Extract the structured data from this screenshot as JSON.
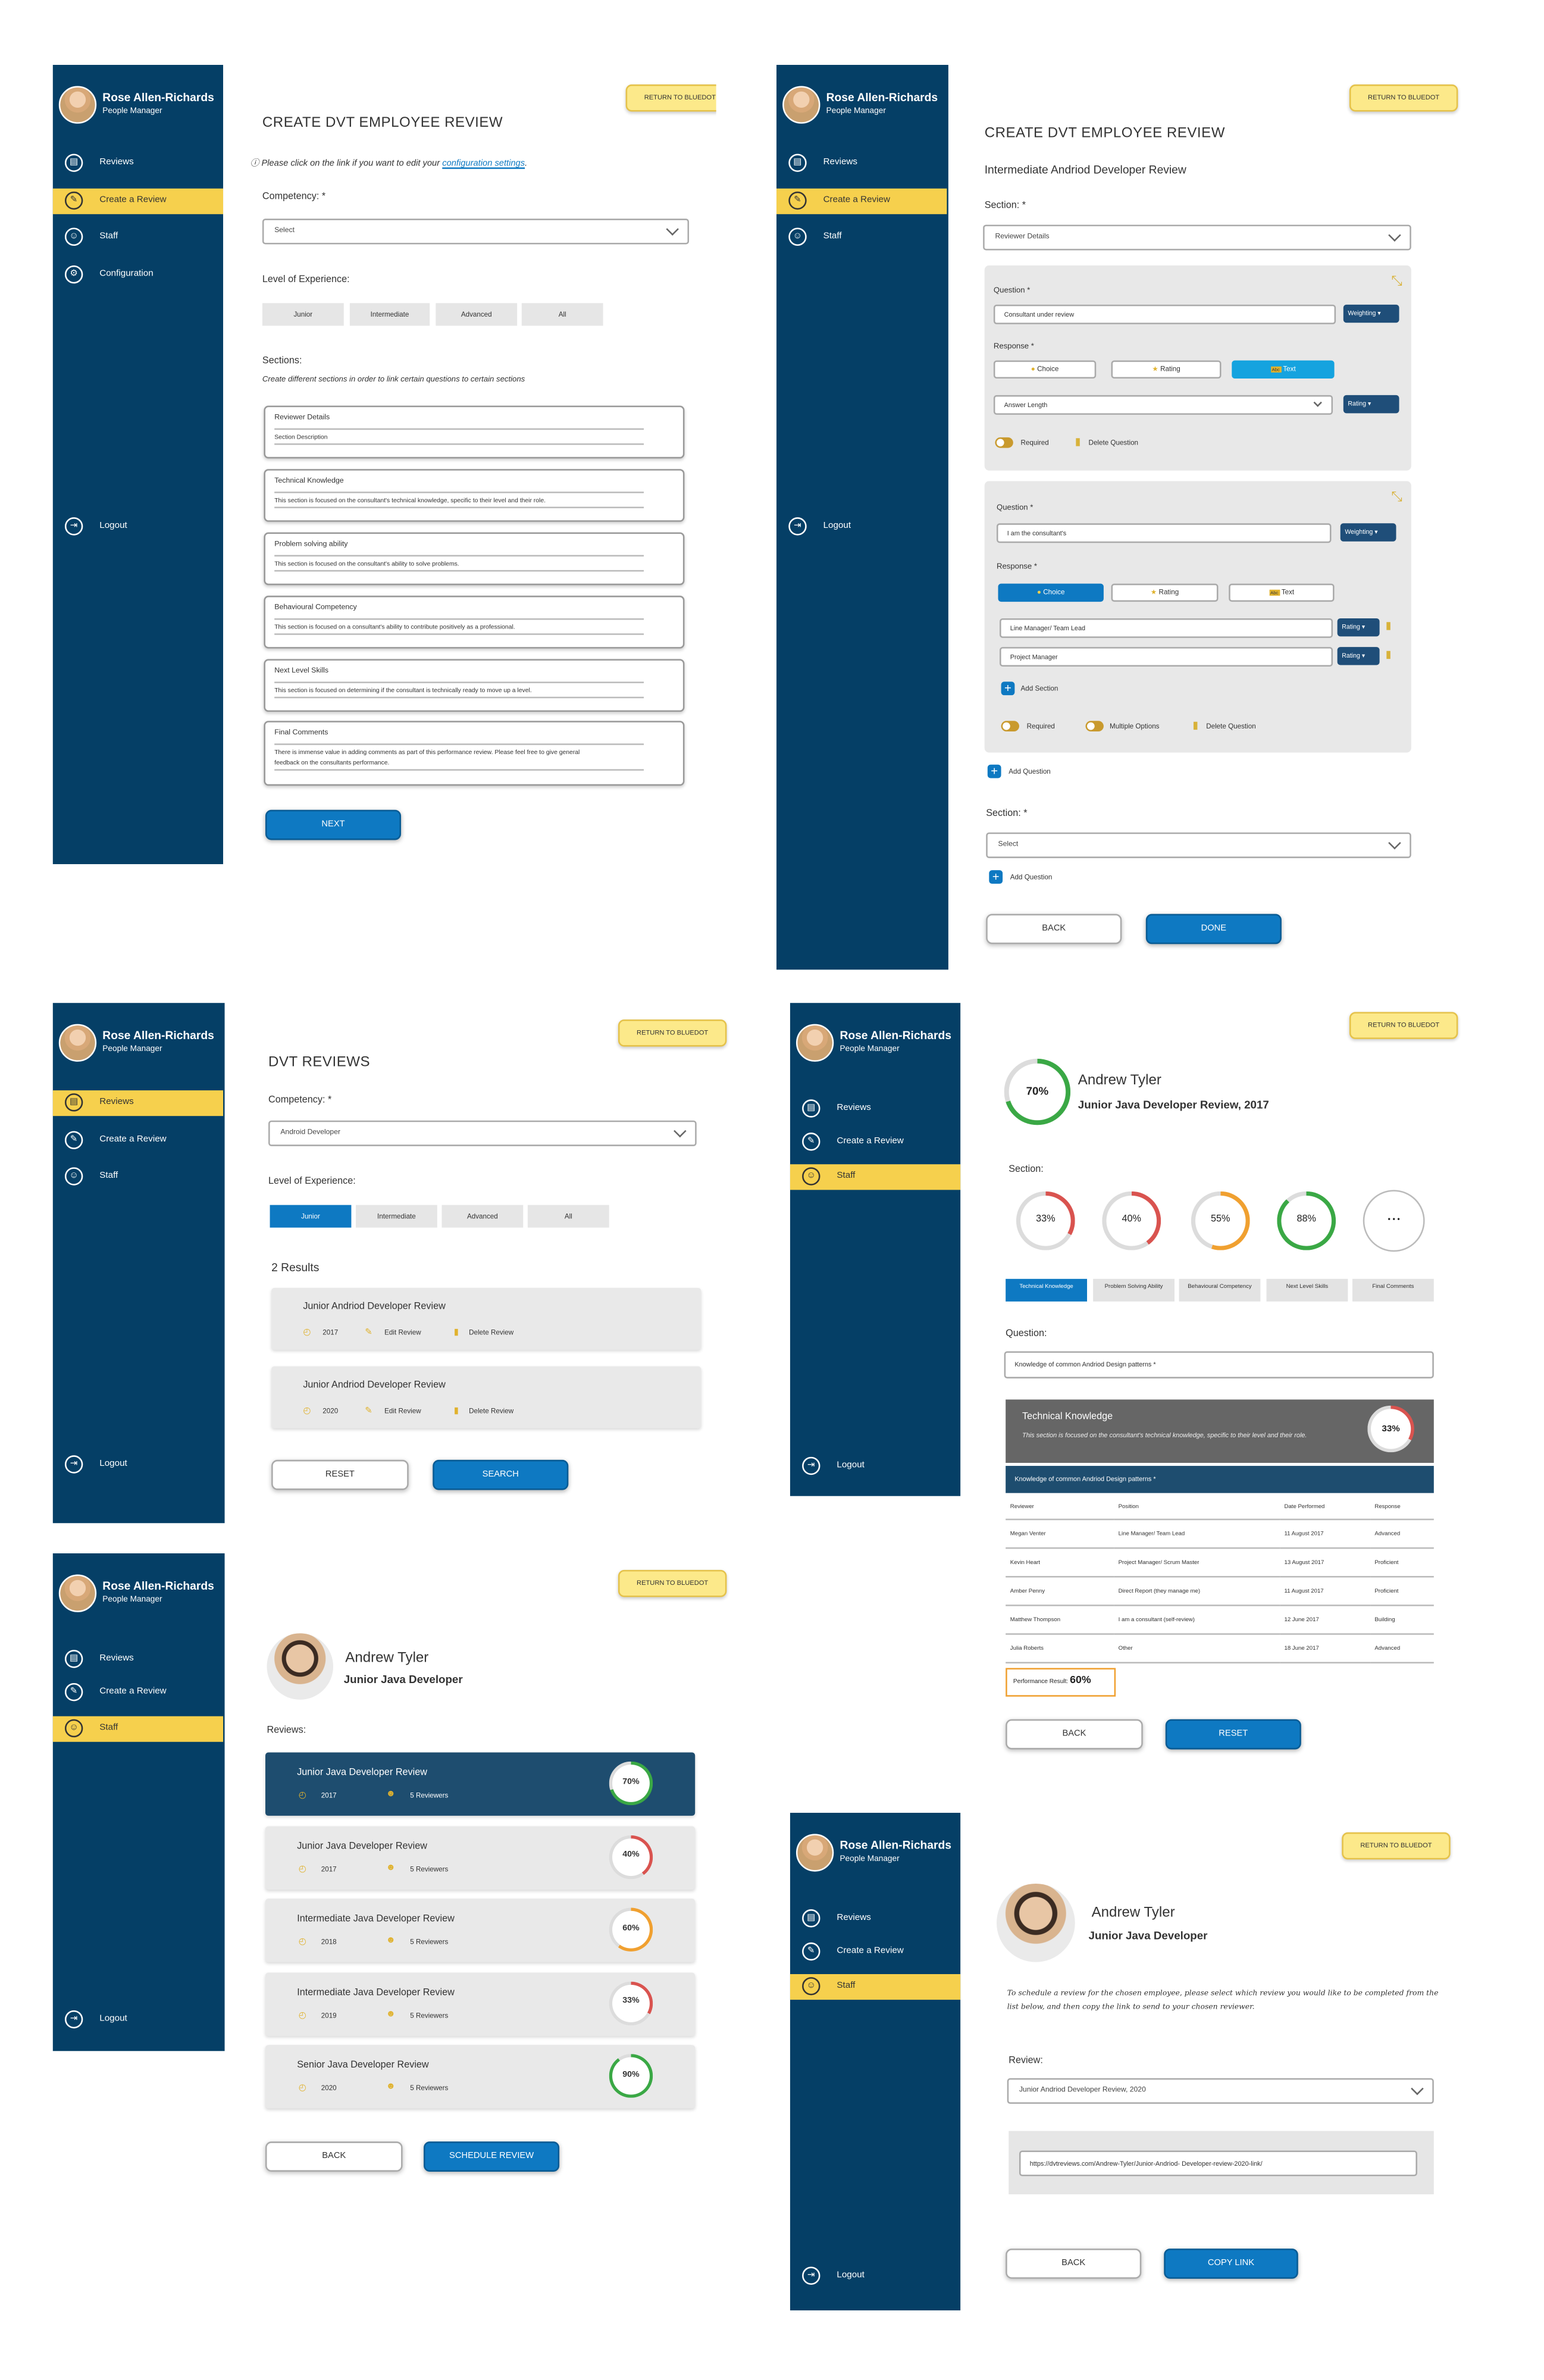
{
  "user": {
    "name": "Rose Allen-Richards",
    "role": "People Manager"
  },
  "return_label": "RETURN TO BLUEDOT",
  "logout": "Logout",
  "nav": {
    "reviews": "Reviews",
    "create": "Create a Review",
    "staff": "Staff",
    "config": "Configuration"
  },
  "p1": {
    "title": "CREATE DVT EMPLOYEE REVIEW",
    "note_pre": "Please click on the link if you want to edit your",
    "note_link": "configuration settings",
    "competency_label": "Competency: *",
    "competency_value": "Select",
    "level_label": "Level of Experience:",
    "levels": [
      "Junior",
      "Intermediate",
      "Advanced",
      "All"
    ],
    "sections_label": "Sections:",
    "sections_hint": "Create different sections in order to link certain questions to certain sections",
    "sections": [
      {
        "title": "Reviewer Details",
        "desc": "Section Description",
        "desc2": ""
      },
      {
        "title": "Technical Knowledge",
        "desc": "This section is focused on the consultant's technical knowledge, specific to their level and their role.",
        "desc2": ""
      },
      {
        "title": "Problem solving ability",
        "desc": "This section is focused on the consultant's ability to solve problems.",
        "desc2": ""
      },
      {
        "title": "Behavioural Competency",
        "desc": "This section is focused on a consultant's ability to contribute positively as a professional.",
        "desc2": ""
      },
      {
        "title": "Next Level Skills",
        "desc": "This section is focused on determining if the consultant is technically ready to move up a level.",
        "desc2": ""
      },
      {
        "title": "Final Comments",
        "desc": "There is immense value in adding comments as part of this performance review. Please feel free to give general",
        "desc2": "feedback on the consultants performance."
      }
    ],
    "next": "NEXT"
  },
  "p2": {
    "title": "CREATE DVT EMPLOYEE REVIEW",
    "subtitle": "Intermediate Andriod Developer Review",
    "section_label": "Section: *",
    "section_value": "Reviewer Details",
    "q_label": "Question *",
    "q1_value": "Consultant under review",
    "weighting": "Weighting",
    "response_label": "Response *",
    "types": [
      "Choice",
      "Rating",
      "Text"
    ],
    "answer_length": "Answer Length",
    "rating": "Rating",
    "required": "Required",
    "delete_q": "Delete Question",
    "q2_value": "I am the consultant's",
    "opt1": "Line Manager/ Team Lead",
    "opt2": "Project Manager",
    "add_section": "Add Section",
    "multiple": "Multiple Options",
    "add_question": "Add Question",
    "section2_value": "Select",
    "back": "BACK",
    "done": "DONE"
  },
  "p3": {
    "title": "DVT REVIEWS",
    "competency_label": "Competency: *",
    "competency_value": "Android Developer",
    "level_label": "Level of Experience:",
    "levels": [
      "Junior",
      "Intermediate",
      "Advanced",
      "All"
    ],
    "results": "2 Results",
    "items": [
      {
        "title": "Junior Andriod Developer Review",
        "year": "2017"
      },
      {
        "title": "Junior Andriod Developer Review",
        "year": "2020"
      }
    ],
    "edit": "Edit Review",
    "delete": "Delete Review",
    "reset": "RESET",
    "search": "SEARCH"
  },
  "p4": {
    "score": "70%",
    "name": "Andrew Tyler",
    "review": "Junior Java Developer Review, 2017",
    "section_label": "Section:",
    "rings": [
      {
        "v": "33%",
        "p": 0.33,
        "c": "#d9534f"
      },
      {
        "v": "40%",
        "p": 0.4,
        "c": "#d9534f"
      },
      {
        "v": "55%",
        "p": 0.55,
        "c": "#f0a030"
      },
      {
        "v": "88%",
        "p": 0.88,
        "c": "#3aa845"
      }
    ],
    "more": "• • •",
    "tabs": [
      "Technical Knowledge",
      "Problem Solving Ability",
      "Behavioural Competency",
      "Next Level Skills",
      "Final Comments"
    ],
    "question_label": "Question:",
    "question_value": "Knowledge of common Andriod Design patterns *",
    "tk_title": "Technical Knowledge",
    "tk_desc": "This section is focused on the consultant's technical knowledge, specific to their level and their role.",
    "tk_score": "33%",
    "table_caption": "Knowledge of common Andriod Design patterns *",
    "headers": [
      "Reviewer",
      "Position",
      "Date Performed",
      "Response"
    ],
    "rows": [
      [
        "Megan Venter",
        "Line Manager/ Team Lead",
        "11 August 2017",
        "Advanced"
      ],
      [
        "Kevin Heart",
        "Project Manager/ Scrum Master",
        "13 August 2017",
        "Proficient"
      ],
      [
        "Amber Penny",
        "Direct Report (they manage me)",
        "11 August 2017",
        "Proficient"
      ],
      [
        "Matthew Thompson",
        "I am a consultant (self-review)",
        "12 June 2017",
        "Building"
      ],
      [
        "Julia Roberts",
        "Other",
        "18 June 2017",
        "Advanced"
      ]
    ],
    "perf_label": "Performance Result:",
    "perf_value": "60%",
    "back": "BACK",
    "reset": "RESET"
  },
  "p5": {
    "name": "Andrew Tyler",
    "role": "Junior Java Developer",
    "reviews_label": "Reviews:",
    "items": [
      {
        "title": "Junior Java Developer Review",
        "year": "2017",
        "reviewers": "5 Reviewers",
        "score": "70%",
        "p": 0.7,
        "c": "#3aa845"
      },
      {
        "title": "Junior Java Developer Review",
        "year": "2017",
        "reviewers": "5 Reviewers",
        "score": "40%",
        "p": 0.4,
        "c": "#d9534f"
      },
      {
        "title": "Intermediate Java Developer Review",
        "year": "2018",
        "reviewers": "5 Reviewers",
        "score": "60%",
        "p": 0.6,
        "c": "#f0a030"
      },
      {
        "title": "Intermediate Java Developer Review",
        "year": "2019",
        "reviewers": "5 Reviewers",
        "score": "33%",
        "p": 0.33,
        "c": "#d9534f"
      },
      {
        "title": "Senior Java Developer Review",
        "year": "2020",
        "reviewers": "5 Reviewers",
        "score": "90%",
        "p": 0.9,
        "c": "#3aa845"
      }
    ],
    "back": "BACK",
    "schedule": "SCHEDULE REVIEW"
  },
  "p6": {
    "name": "Andrew Tyler",
    "role": "Junior Java Developer",
    "instructions": "To schedule a review for the chosen employee, please select which review you would like to be completed from the list below, and then copy the link to send to your chosen reviewer.",
    "review_label": "Review:",
    "review_value": "Junior Andriod Developer Review, 2020",
    "link": "https://dvtreviews.com/Andrew-Tyler/Junior-Andriod- Developer-review-2020-link/",
    "back": "BACK",
    "copy": "COPY LINK"
  }
}
